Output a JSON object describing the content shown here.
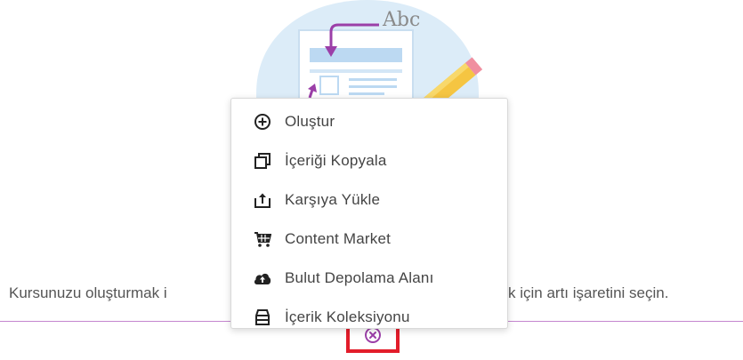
{
  "illustration": {
    "caption": "Abc"
  },
  "menu": {
    "items": [
      {
        "label": "Oluştur",
        "icon": "plus-circle-icon"
      },
      {
        "label": "İçeriği Kopyala",
        "icon": "copy-icon"
      },
      {
        "label": "Karşıya Yükle",
        "icon": "upload-icon"
      },
      {
        "label": "Content Market",
        "icon": "cart-icon"
      },
      {
        "label": "Bulut Depolama Alanı",
        "icon": "cloud-upload-icon"
      },
      {
        "label": "İçerik Koleksiyonu",
        "icon": "collection-icon"
      }
    ]
  },
  "instruction": {
    "text_left": "Kursunuzu oluşturmak i",
    "text_right": "k için artı işaretini seçin."
  },
  "colors": {
    "accent": "#9b3fa8",
    "divider": "#c486cf",
    "highlight": "#e21c2a",
    "illustration_bg": "#dcecf8"
  }
}
